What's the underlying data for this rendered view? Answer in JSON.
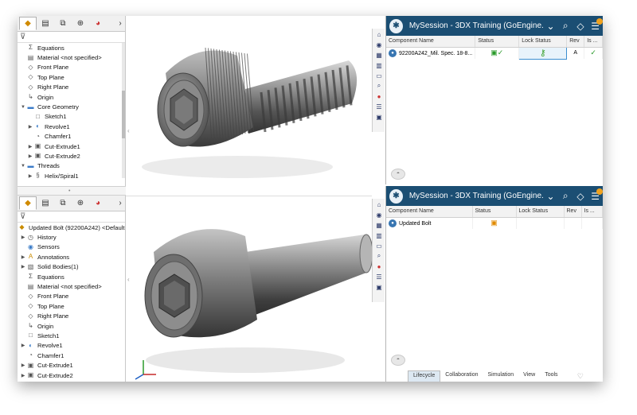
{
  "fm_top": {
    "tabs": [
      "feature-manager",
      "property-manager",
      "configuration-manager",
      "dimxpert",
      "display-manager"
    ],
    "items": [
      {
        "label": "Equations",
        "icon": "equations-icon",
        "twisty": ""
      },
      {
        "label": "Material <not specified>",
        "icon": "material-icon",
        "twisty": ""
      },
      {
        "label": "Front Plane",
        "icon": "plane-icon",
        "twisty": ""
      },
      {
        "label": "Top Plane",
        "icon": "plane-icon",
        "twisty": ""
      },
      {
        "label": "Right Plane",
        "icon": "plane-icon",
        "twisty": ""
      },
      {
        "label": "Origin",
        "icon": "origin-icon",
        "twisty": ""
      },
      {
        "label": "Core Geometry",
        "icon": "folder-icon",
        "twisty": "▼"
      },
      {
        "label": "Sketch1",
        "icon": "sketch-icon",
        "twisty": ""
      },
      {
        "label": "Revolve1",
        "icon": "revolve-icon",
        "twisty": "▶"
      },
      {
        "label": "Chamfer1",
        "icon": "chamfer-icon",
        "twisty": ""
      },
      {
        "label": "Cut-Extrude1",
        "icon": "cut-extrude-icon",
        "twisty": "▶"
      },
      {
        "label": "Cut-Extrude2",
        "icon": "cut-extrude-icon",
        "twisty": "▶"
      },
      {
        "label": "Threads",
        "icon": "folder-icon",
        "twisty": "▼"
      },
      {
        "label": "Helix/Spiral1",
        "icon": "helix-icon",
        "twisty": "▶"
      }
    ]
  },
  "fm_bot": {
    "root": "Updated Bolt (92200A242) <Default Displ",
    "items": [
      {
        "label": "History",
        "icon": "history-icon",
        "twisty": "▶"
      },
      {
        "label": "Sensors",
        "icon": "sensor-icon",
        "twisty": ""
      },
      {
        "label": "Annotations",
        "icon": "annotation-icon",
        "twisty": "▶"
      },
      {
        "label": "Solid Bodies(1)",
        "icon": "solid-bodies-icon",
        "twisty": "▶"
      },
      {
        "label": "Equations",
        "icon": "equations-icon",
        "twisty": ""
      },
      {
        "label": "Material <not specified>",
        "icon": "material-icon",
        "twisty": ""
      },
      {
        "label": "Front Plane",
        "icon": "plane-icon",
        "twisty": ""
      },
      {
        "label": "Top Plane",
        "icon": "plane-icon",
        "twisty": ""
      },
      {
        "label": "Right Plane",
        "icon": "plane-icon",
        "twisty": ""
      },
      {
        "label": "Origin",
        "icon": "origin-icon",
        "twisty": ""
      },
      {
        "label": "Sketch1",
        "icon": "sketch-icon",
        "twisty": ""
      },
      {
        "label": "Revolve1",
        "icon": "revolve-icon",
        "twisty": "▶"
      },
      {
        "label": "Chamfer1",
        "icon": "chamfer-icon",
        "twisty": ""
      },
      {
        "label": "Cut-Extrude1",
        "icon": "cut-extrude-icon",
        "twisty": "▶"
      },
      {
        "label": "Cut-Extrude2",
        "icon": "cut-extrude-icon",
        "twisty": "▶"
      }
    ]
  },
  "dx_top": {
    "title": "MySession - 3DX Training (GoEngine...",
    "columns": [
      "Component Name",
      "Status",
      "Lock Status",
      "Rev",
      "Is ..."
    ],
    "row": {
      "name": "92200A242_Mil. Spec. 18-8...",
      "rev": "A"
    }
  },
  "dx_bot": {
    "title": "MySession - 3DX Training (GoEngine...",
    "columns": [
      "Component Name",
      "Status",
      "Lock Status",
      "Rev",
      "Is ..."
    ],
    "row": {
      "name": "Updated Bolt"
    },
    "tabs": [
      "Lifecycle",
      "Collaboration",
      "Simulation",
      "View",
      "Tools"
    ],
    "active_tab": "Lifecycle"
  },
  "colors": {
    "accent": "#1b4e73",
    "lock_green": "#3aa02c",
    "badge": "#f1a21e"
  }
}
